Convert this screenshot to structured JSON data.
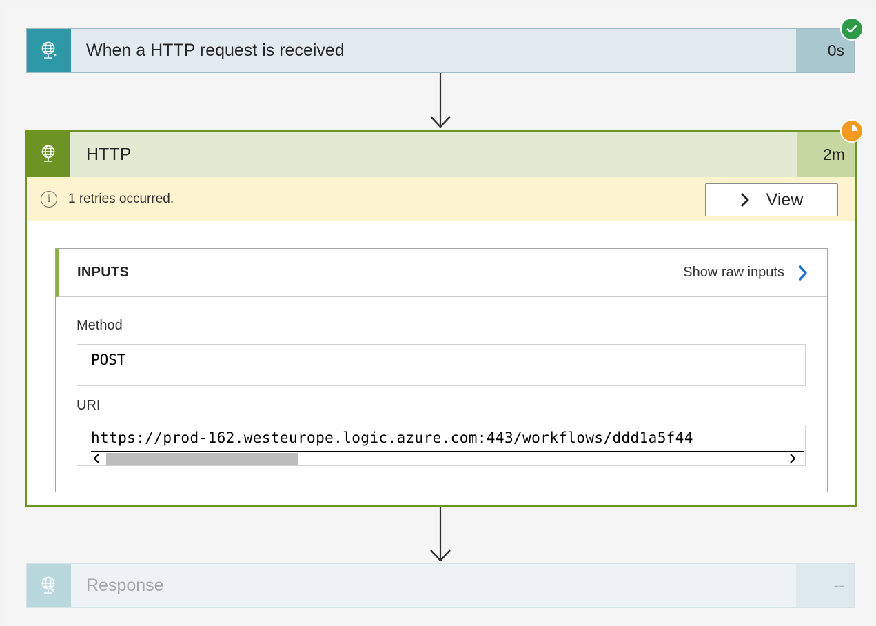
{
  "steps": {
    "trigger": {
      "title": "When a HTTP request is received",
      "duration": "0s",
      "status": "succeeded",
      "icon": "http-trigger-icon"
    },
    "http": {
      "title": "HTTP",
      "duration": "2m",
      "status": "running",
      "icon": "http-globe-icon",
      "retry_message": "1 retries occurred.",
      "view_label": "View",
      "inputs": {
        "title": "INPUTS",
        "show_raw_label": "Show raw inputs",
        "method_label": "Method",
        "method_value": "POST",
        "uri_label": "URI",
        "uri_value": "https://prod-162.westeurope.logic.azure.com:443/workflows/ddd1a5f44"
      }
    },
    "response": {
      "title": "Response",
      "duration": "--",
      "status": "pending",
      "icon": "response-globe-icon"
    }
  },
  "colors": {
    "trigger_accent": "#2e98a6",
    "http_accent": "#6d9324",
    "success": "#2f9a48",
    "running": "#f29b21",
    "retry_banner": "#fdf3cf",
    "link_chevron": "#1e73c8"
  }
}
